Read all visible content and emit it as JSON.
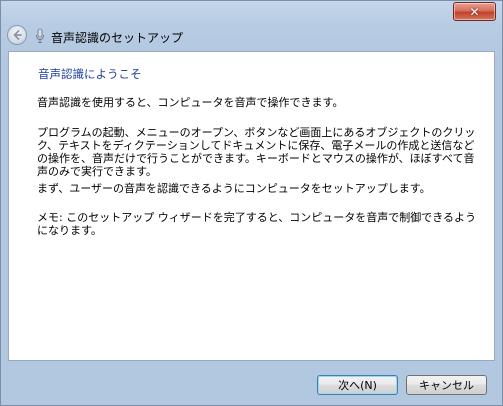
{
  "window": {
    "close_label": "✕"
  },
  "nav": {
    "back_icon": "back-arrow-icon",
    "app_icon": "microphone-icon",
    "title": "音声認識のセットアップ"
  },
  "content": {
    "heading": "音声認識にようこそ",
    "p1": "音声認識を使用すると、コンピュータを音声で操作できます。",
    "p2": "プログラムの起動、メニューのオープン、ボタンなど画面上にあるオブジェクトのクリック、テキストをディクテーションしてドキュメントに保存、電子メールの作成と送信などの操作を、音声だけで行うことができます。キーボードとマウスの操作が、ほぼすべて音声のみで実行できます。",
    "p3": "まず、ユーザーの音声を認識できるようにコンピュータをセットアップします。",
    "p4": "メモ: このセットアップ ウィザードを完了すると、コンピュータを音声で制御できるようになります。"
  },
  "footer": {
    "next_label": "次へ(N)",
    "cancel_label": "キャンセル"
  },
  "colors": {
    "heading": "#1f3fa0",
    "frame": "#b7cce3",
    "close_button": "#c2422a"
  }
}
